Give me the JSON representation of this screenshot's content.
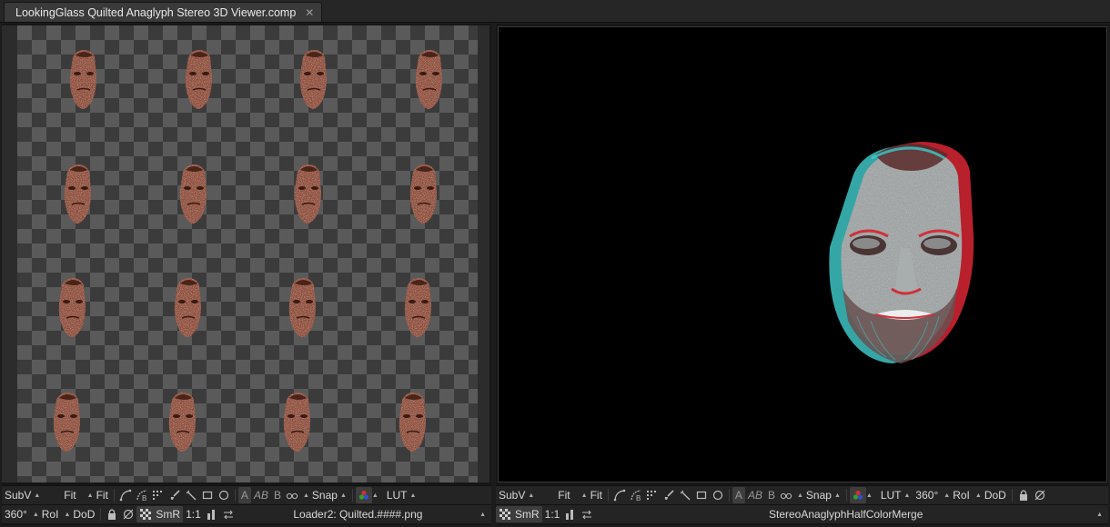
{
  "tab": {
    "title": "LookingGlass Quilted Anaglyph Stereo 3D Viewer.comp",
    "close_glyph": "✕"
  },
  "left_viewer": {
    "subv": "SubV",
    "fit1": "Fit",
    "fit2": "Fit",
    "a": "A",
    "ab": "AB",
    "b": "B",
    "snap": "Snap",
    "lut": "LUT",
    "angle": "360°",
    "roi": "RoI",
    "dod": "DoD",
    "smr": "SmR",
    "ratio": "1:1",
    "filename": "Loader2: Quilted.####.png",
    "quilt_rows": 4,
    "quilt_cols": 4
  },
  "right_viewer": {
    "subv": "SubV",
    "fit1": "Fit",
    "fit2": "Fit",
    "a": "A",
    "ab": "AB",
    "b": "B",
    "snap": "Snap",
    "lut": "LUT",
    "angle": "360°",
    "roi": "RoI",
    "dod": "DoD",
    "smr": "SmR",
    "ratio": "1:1",
    "node_name": "StereoAnaglyphHalfColorMerge"
  },
  "colors": {
    "anaglyph_red": "#d0303a",
    "anaglyph_cyan": "#3fc8c8",
    "face_tone": "#8a4a38",
    "checker_dark": "#3b3b3b",
    "checker_light": "#5a5a5a"
  }
}
